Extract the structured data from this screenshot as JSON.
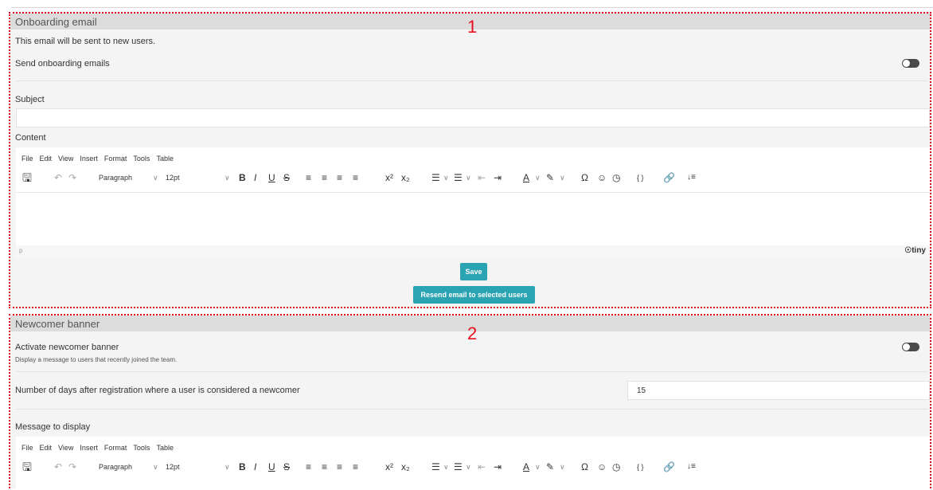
{
  "onboarding": {
    "marker": "1",
    "title": "Onboarding email",
    "description": "This email will be sent to new users.",
    "send_label": "Send onboarding emails",
    "send_enabled": false,
    "subject_label": "Subject",
    "subject_value": "",
    "content_label": "Content",
    "save_label": "Save",
    "resend_label": "Resend email to selected users"
  },
  "newcomer": {
    "marker": "2",
    "title": "Newcomer banner",
    "activate_label": "Activate newcomer banner",
    "activate_hint": "Display a message to users that recently joined the team.",
    "activate_enabled": false,
    "days_label": "Number of days after registration where a user is considered a newcomer",
    "days_value": "15",
    "message_label": "Message to display"
  },
  "editor": {
    "menu": [
      "File",
      "Edit",
      "View",
      "Insert",
      "Format",
      "Tools",
      "Table"
    ],
    "block_format": "Paragraph",
    "font_size": "12pt",
    "status_path": "p",
    "brand": "tiny",
    "tools": {
      "save": "🖫",
      "undo": "↶",
      "redo": "↷",
      "bold": "B",
      "italic": "I",
      "underline": "U",
      "strike": "S",
      "align_left": "≡",
      "align_center": "≡",
      "align_right": "≡",
      "align_justify": "≡",
      "superscript": "x²",
      "subscript": "x₂",
      "bullets": "☰",
      "numbers": "☰",
      "outdent": "⇤",
      "indent": "⇥",
      "text_color": "A",
      "highlight": "✎",
      "special_char": "Ω",
      "emoji": "☺",
      "datetime": "◷",
      "variables": "{ }",
      "link": "🔗",
      "more": "↓≡",
      "chevron": "∨"
    }
  },
  "colors": {
    "accent": "#2aa3b3",
    "annotation": "#e0001b",
    "header": "#dcdcdc"
  }
}
